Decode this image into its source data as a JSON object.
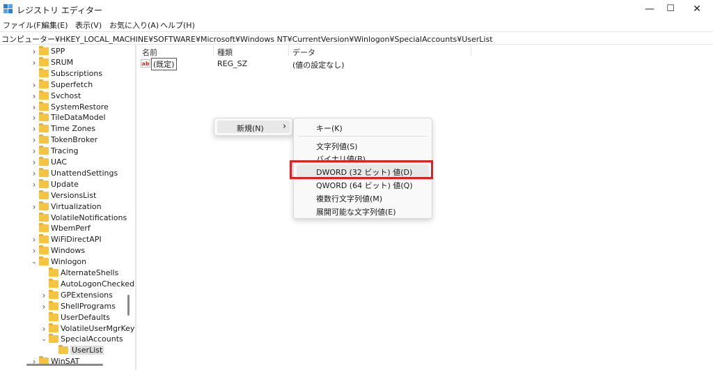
{
  "window": {
    "title": "レジストリ エディター",
    "controls": {
      "minimize": "—",
      "maximize": "☐",
      "close": "✕"
    }
  },
  "menu": [
    "ファイル(F)",
    "編集(E)",
    "表示(V)",
    "お気に入り(A)",
    "ヘルプ(H)"
  ],
  "address": "コンピューター¥HKEY_LOCAL_MACHINE¥SOFTWARE¥Microsoft¥Windows NT¥CurrentVersion¥Winlogon¥SpecialAccounts¥UserList",
  "tree": [
    {
      "label": "SPP",
      "level": 0,
      "state": "collapsed"
    },
    {
      "label": "SRUM",
      "level": 0,
      "state": "collapsed"
    },
    {
      "label": "Subscriptions",
      "level": 0,
      "state": "none"
    },
    {
      "label": "Superfetch",
      "level": 0,
      "state": "collapsed"
    },
    {
      "label": "Svchost",
      "level": 0,
      "state": "collapsed"
    },
    {
      "label": "SystemRestore",
      "level": 0,
      "state": "collapsed"
    },
    {
      "label": "TileDataModel",
      "level": 0,
      "state": "collapsed"
    },
    {
      "label": "Time Zones",
      "level": 0,
      "state": "collapsed"
    },
    {
      "label": "TokenBroker",
      "level": 0,
      "state": "collapsed"
    },
    {
      "label": "Tracing",
      "level": 0,
      "state": "collapsed"
    },
    {
      "label": "UAC",
      "level": 0,
      "state": "collapsed"
    },
    {
      "label": "UnattendSettings",
      "level": 0,
      "state": "collapsed"
    },
    {
      "label": "Update",
      "level": 0,
      "state": "collapsed"
    },
    {
      "label": "VersionsList",
      "level": 0,
      "state": "none"
    },
    {
      "label": "Virtualization",
      "level": 0,
      "state": "collapsed"
    },
    {
      "label": "VolatileNotifications",
      "level": 0,
      "state": "none"
    },
    {
      "label": "WbemPerf",
      "level": 0,
      "state": "none"
    },
    {
      "label": "WiFiDirectAPI",
      "level": 0,
      "state": "collapsed"
    },
    {
      "label": "Windows",
      "level": 0,
      "state": "collapsed"
    },
    {
      "label": "Winlogon",
      "level": 0,
      "state": "expanded"
    },
    {
      "label": "AlternateShells",
      "level": 1,
      "state": "none"
    },
    {
      "label": "AutoLogonChecked",
      "level": 1,
      "state": "none"
    },
    {
      "label": "GPExtensions",
      "level": 1,
      "state": "collapsed"
    },
    {
      "label": "ShellPrograms",
      "level": 1,
      "state": "collapsed"
    },
    {
      "label": "UserDefaults",
      "level": 1,
      "state": "none"
    },
    {
      "label": "VolatileUserMgrKey",
      "level": 1,
      "state": "collapsed"
    },
    {
      "label": "SpecialAccounts",
      "level": 1,
      "state": "expanded"
    },
    {
      "label": "UserList",
      "level": 2,
      "state": "none",
      "selected": true
    },
    {
      "label": "WinSAT",
      "level": 0,
      "state": "collapsed"
    }
  ],
  "list": {
    "columns": [
      "名前",
      "種類",
      "データ"
    ],
    "rows": [
      {
        "name": "(既定)",
        "type": "REG_SZ",
        "data": "(値の設定なし)",
        "icon": "ab-string-icon"
      }
    ]
  },
  "context_menu": {
    "item": "新規(N)",
    "arrow": "›"
  },
  "submenu": {
    "groups": [
      [
        "キー(K)"
      ],
      [
        "文字列値(S)",
        "バイナリ値(B)",
        "DWORD (32 ビット) 値(D)",
        "QWORD (64 ビット) 値(Q)",
        "複数行文字列値(M)",
        "展開可能な文字列値(E)"
      ]
    ],
    "hovered": "DWORD (32 ビット) 値(D)"
  },
  "colors": {
    "highlight_border": "#e02020",
    "folder": "#f5c542"
  }
}
